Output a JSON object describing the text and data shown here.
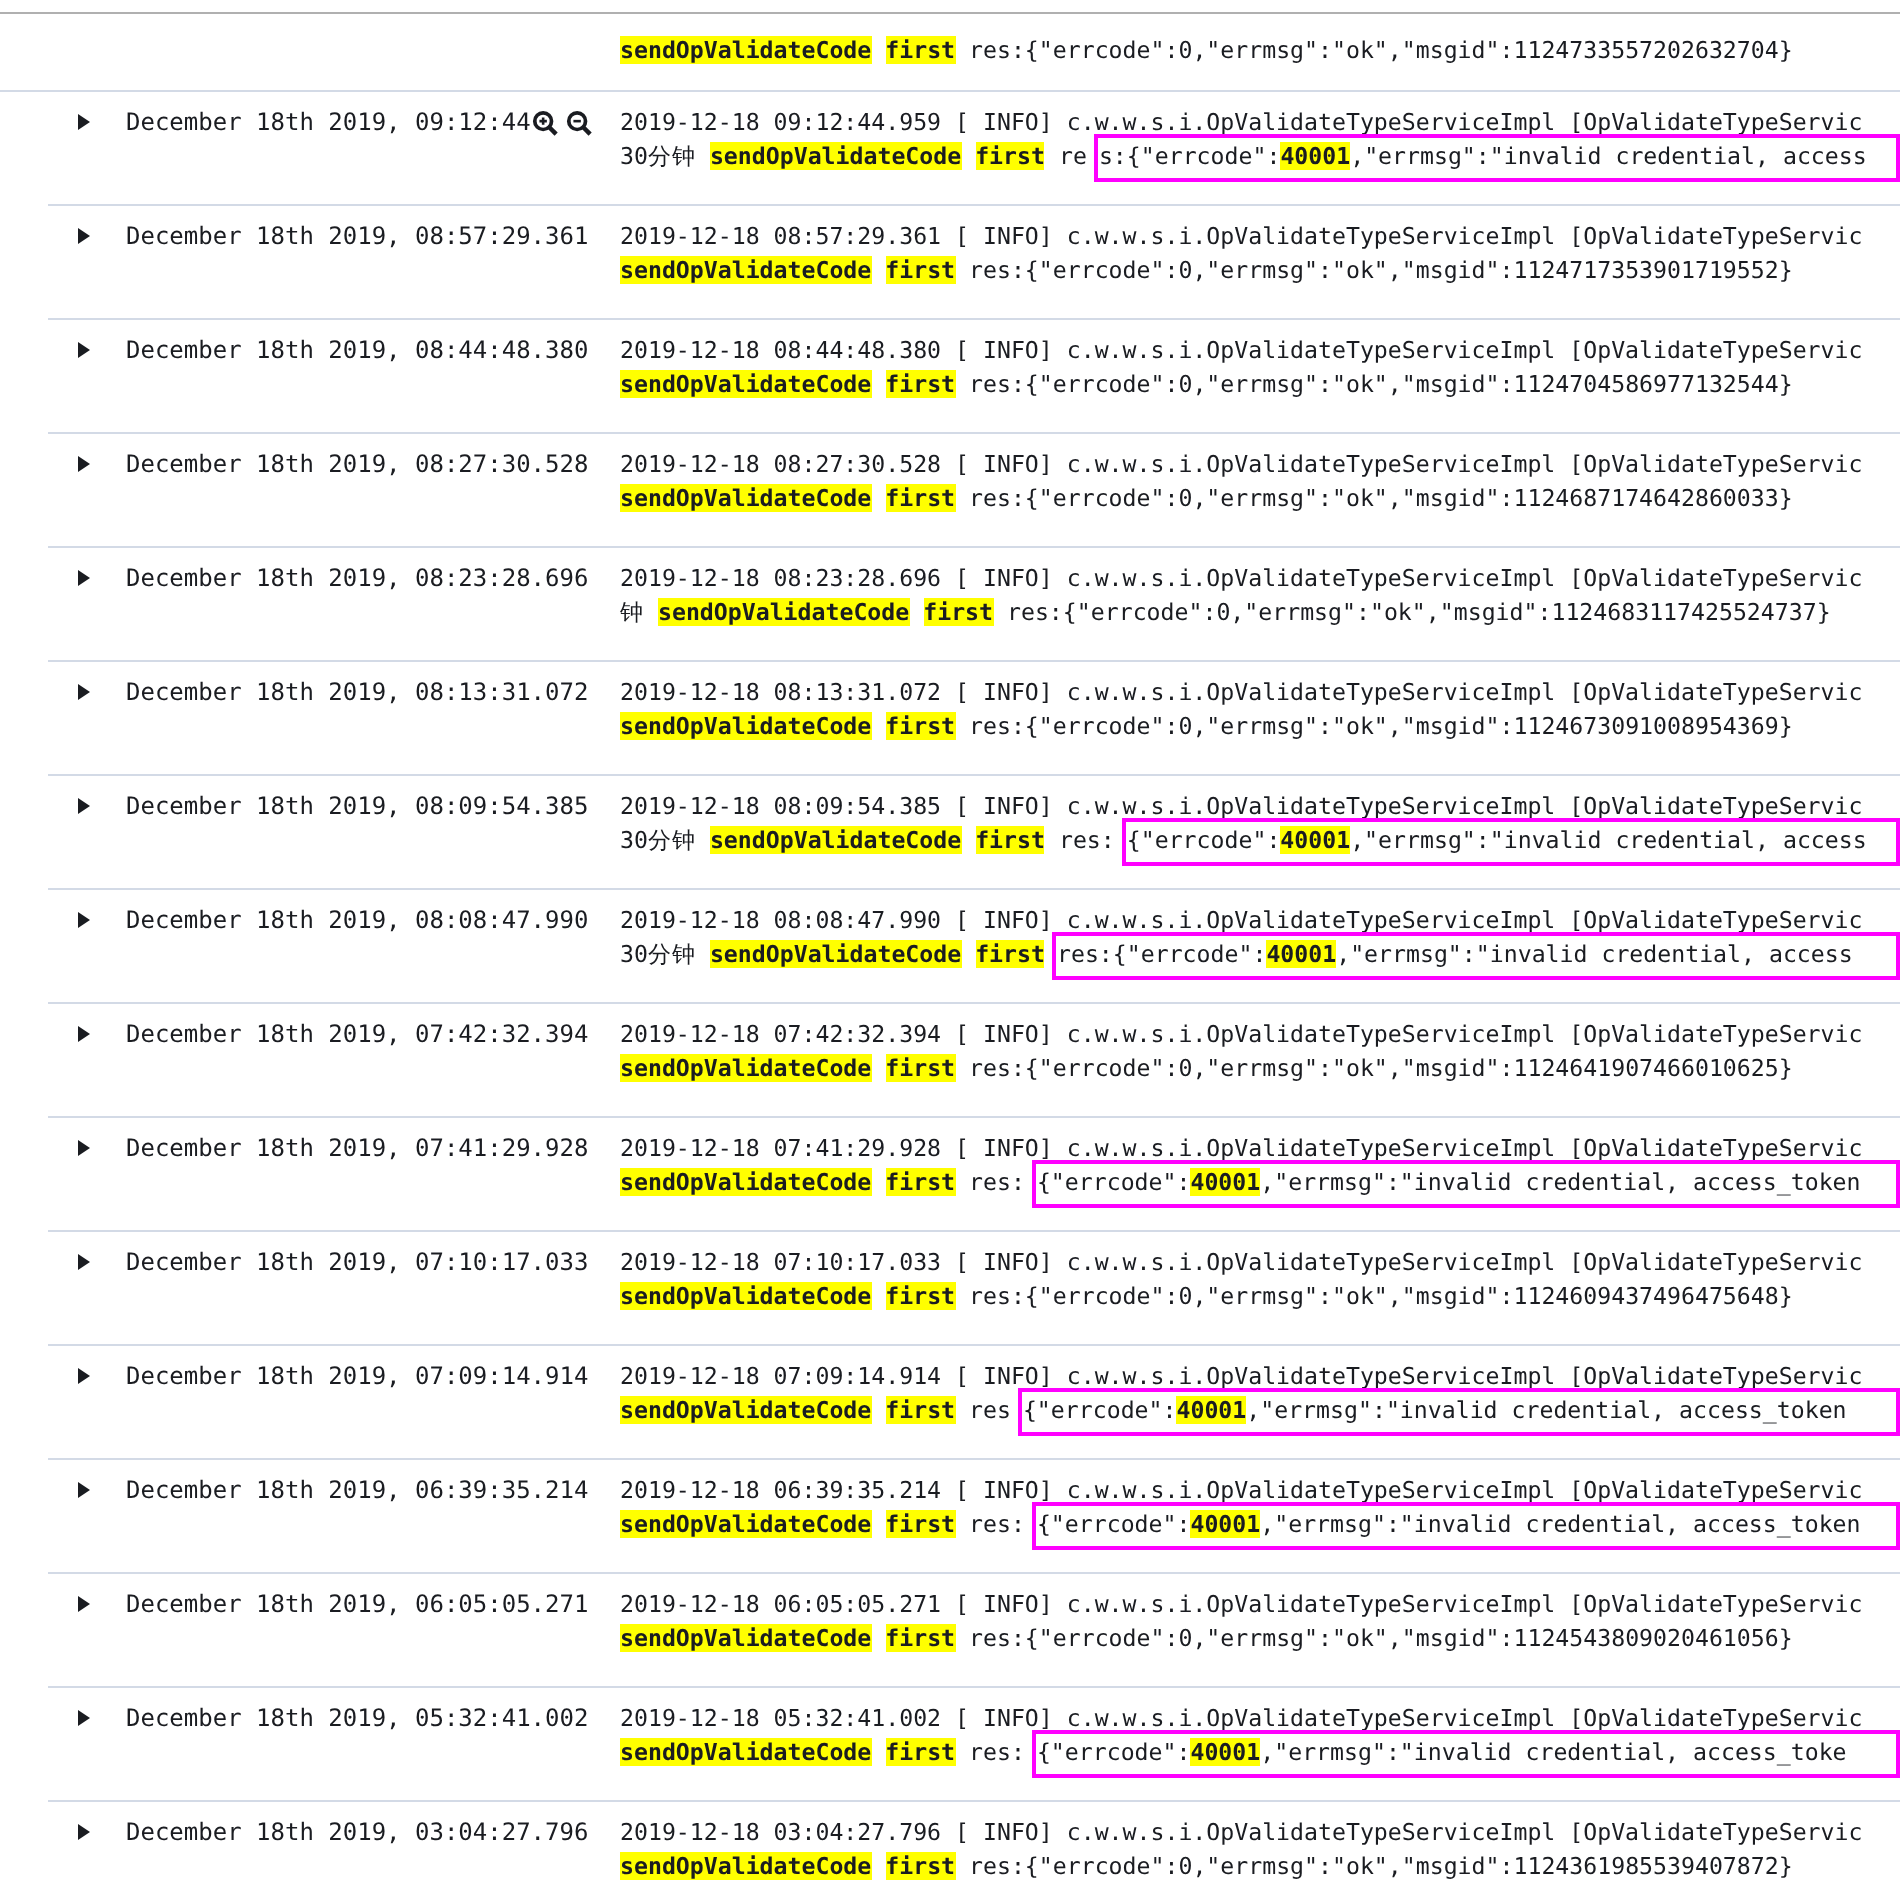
{
  "top_fragment": {
    "message": {
      "text": "**sendOpValidateCode** **first** res:{\"errcode\":0,\"errmsg\":\"ok\",\"msgid\":1124733557202632704}"
    }
  },
  "rows": [
    {
      "expanded": false,
      "hovered": true,
      "time": "December 18th 2019, 09:12:44",
      "line1": "2019-12-18 09:12:44.959 [ INFO] c.w.w.s.i.OpValidateTypeServiceImpl [OpValidateTypeServic",
      "message": {
        "text": "30分钟 **sendOpValidateCode** **first** re",
        "boxed_text": "s:{\"errcode\":**40001**,\"errmsg\":\"invalid credential, access"
      }
    },
    {
      "expanded": false,
      "hovered": false,
      "time": "December 18th 2019, 08:57:29.361",
      "line1": "2019-12-18 08:57:29.361 [ INFO] c.w.w.s.i.OpValidateTypeServiceImpl [OpValidateTypeServic",
      "message": {
        "text": "**sendOpValidateCode** **first** res:{\"errcode\":0,\"errmsg\":\"ok\",\"msgid\":1124717353901719552}"
      }
    },
    {
      "expanded": false,
      "hovered": false,
      "time": "December 18th 2019, 08:44:48.380",
      "line1": "2019-12-18 08:44:48.380 [ INFO] c.w.w.s.i.OpValidateTypeServiceImpl [OpValidateTypeServic",
      "message": {
        "text": "**sendOpValidateCode** **first** res:{\"errcode\":0,\"errmsg\":\"ok\",\"msgid\":1124704586977132544}"
      }
    },
    {
      "expanded": false,
      "hovered": false,
      "time": "December 18th 2019, 08:27:30.528",
      "line1": "2019-12-18 08:27:30.528 [ INFO] c.w.w.s.i.OpValidateTypeServiceImpl [OpValidateTypeServic",
      "message": {
        "text": "**sendOpValidateCode** **first** res:{\"errcode\":0,\"errmsg\":\"ok\",\"msgid\":1124687174642860033}"
      }
    },
    {
      "expanded": false,
      "hovered": false,
      "time": "December 18th 2019, 08:23:28.696",
      "line1": "2019-12-18 08:23:28.696 [ INFO] c.w.w.s.i.OpValidateTypeServiceImpl [OpValidateTypeServic",
      "message": {
        "text": "钟 **sendOpValidateCode** **first** res:{\"errcode\":0,\"errmsg\":\"ok\",\"msgid\":1124683117425524737}"
      }
    },
    {
      "expanded": false,
      "hovered": false,
      "time": "December 18th 2019, 08:13:31.072",
      "line1": "2019-12-18 08:13:31.072 [ INFO] c.w.w.s.i.OpValidateTypeServiceImpl [OpValidateTypeServic",
      "message": {
        "text": "**sendOpValidateCode** **first** res:{\"errcode\":0,\"errmsg\":\"ok\",\"msgid\":1124673091008954369}"
      }
    },
    {
      "expanded": false,
      "hovered": false,
      "time": "December 18th 2019, 08:09:54.385",
      "line1": "2019-12-18 08:09:54.385 [ INFO] c.w.w.s.i.OpValidateTypeServiceImpl [OpValidateTypeServic",
      "message": {
        "text": "30分钟 **sendOpValidateCode** **first** res:",
        "boxed_text": "{\"errcode\":**40001**,\"errmsg\":\"invalid credential, access"
      }
    },
    {
      "expanded": false,
      "hovered": false,
      "time": "December 18th 2019, 08:08:47.990",
      "line1": "2019-12-18 08:08:47.990 [ INFO] c.w.w.s.i.OpValidateTypeServiceImpl [OpValidateTypeServic",
      "message": {
        "text": "30分钟 **sendOpValidateCode** **first**",
        "boxed_text": "res:{\"errcode\":**40001**,\"errmsg\":\"invalid credential, access"
      }
    },
    {
      "expanded": false,
      "hovered": false,
      "time": "December 18th 2019, 07:42:32.394",
      "line1": "2019-12-18 07:42:32.394 [ INFO] c.w.w.s.i.OpValidateTypeServiceImpl [OpValidateTypeServic",
      "message": {
        "text": "**sendOpValidateCode** **first** res:{\"errcode\":0,\"errmsg\":\"ok\",\"msgid\":1124641907466010625}"
      }
    },
    {
      "expanded": false,
      "hovered": false,
      "time": "December 18th 2019, 07:41:29.928",
      "line1": "2019-12-18 07:41:29.928 [ INFO] c.w.w.s.i.OpValidateTypeServiceImpl [OpValidateTypeServic",
      "message": {
        "text": "**sendOpValidateCode** **first** res:",
        "boxed_text": "{\"errcode\":**40001**,\"errmsg\":\"invalid credential, access_token"
      }
    },
    {
      "expanded": false,
      "hovered": false,
      "time": "December 18th 2019, 07:10:17.033",
      "line1": "2019-12-18 07:10:17.033 [ INFO] c.w.w.s.i.OpValidateTypeServiceImpl [OpValidateTypeServic",
      "message": {
        "text": "**sendOpValidateCode** **first** res:{\"errcode\":0,\"errmsg\":\"ok\",\"msgid\":1124609437496475648}"
      }
    },
    {
      "expanded": false,
      "hovered": false,
      "time": "December 18th 2019, 07:09:14.914",
      "line1": "2019-12-18 07:09:14.914 [ INFO] c.w.w.s.i.OpValidateTypeServiceImpl [OpValidateTypeServic",
      "message": {
        "text": "**sendOpValidateCode** **first** res",
        "boxed_text": "{\"errcode\":**40001**,\"errmsg\":\"invalid credential, access_token"
      }
    },
    {
      "expanded": false,
      "hovered": false,
      "time": "December 18th 2019, 06:39:35.214",
      "line1": "2019-12-18 06:39:35.214 [ INFO] c.w.w.s.i.OpValidateTypeServiceImpl [OpValidateTypeServic",
      "message": {
        "text": "**sendOpValidateCode** **first** res:",
        "boxed_text": "{\"errcode\":**40001**,\"errmsg\":\"invalid credential, access_token"
      }
    },
    {
      "expanded": false,
      "hovered": false,
      "time": "December 18th 2019, 06:05:05.271",
      "line1": "2019-12-18 06:05:05.271 [ INFO] c.w.w.s.i.OpValidateTypeServiceImpl [OpValidateTypeServic",
      "message": {
        "text": "**sendOpValidateCode** **first** res:{\"errcode\":0,\"errmsg\":\"ok\",\"msgid\":1124543809020461056}"
      }
    },
    {
      "expanded": false,
      "hovered": false,
      "time": "December 18th 2019, 05:32:41.002",
      "line1": "2019-12-18 05:32:41.002 [ INFO] c.w.w.s.i.OpValidateTypeServiceImpl [OpValidateTypeServic",
      "message": {
        "text": "**sendOpValidateCode** **first** res:",
        "boxed_text": "{\"errcode\":**40001**,\"errmsg\":\"invalid credential, access_toke"
      }
    },
    {
      "expanded": false,
      "hovered": false,
      "time": "December 18th 2019, 03:04:27.796",
      "line1": "2019-12-18 03:04:27.796 [ INFO] c.w.w.s.i.OpValidateTypeServiceImpl [OpValidateTypeServic",
      "message": {
        "text": "**sendOpValidateCode** **first** res:{\"errcode\":0,\"errmsg\":\"ok\",\"msgid\":1124361985539407872}"
      }
    }
  ]
}
